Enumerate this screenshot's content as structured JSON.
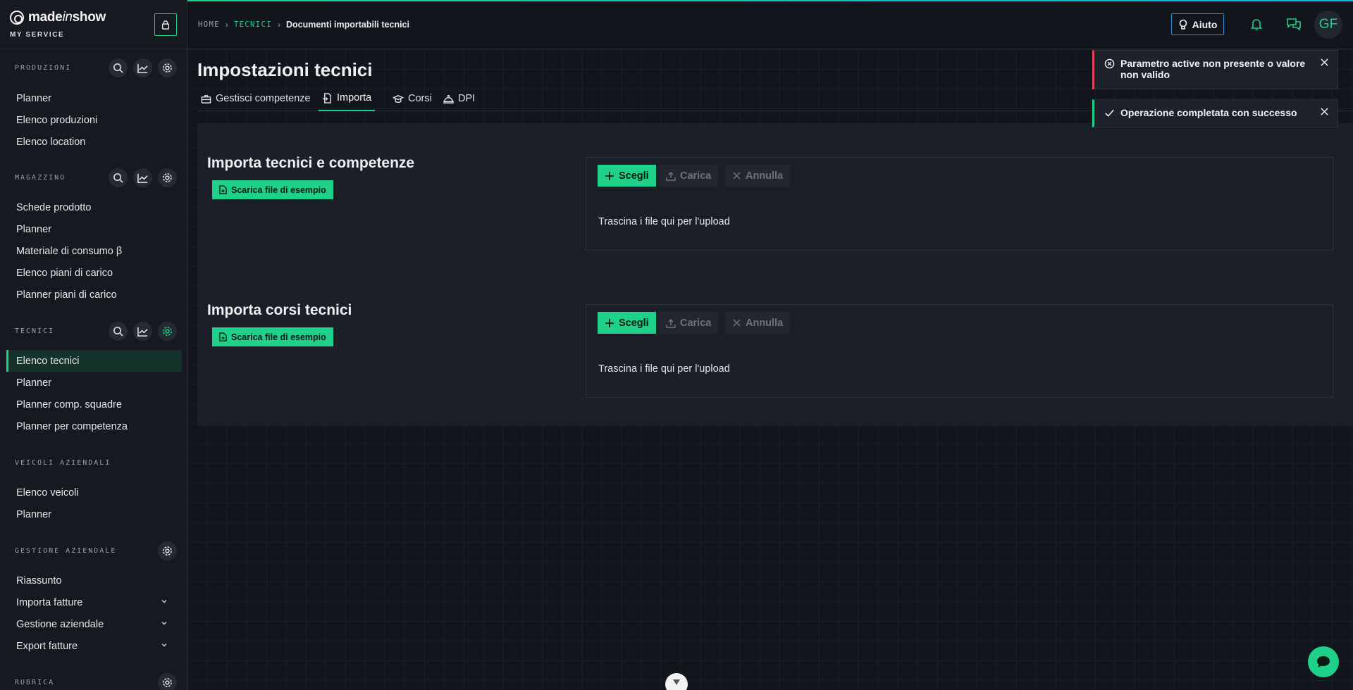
{
  "brand": {
    "name_pre": "made",
    "name_mid": "in",
    "name_post": "show",
    "subtitle": "MY SERVICE"
  },
  "colors": {
    "accent": "#1fd08a",
    "help_border": "#2f8fd6",
    "error": "#e0455a"
  },
  "sidebar": {
    "sections": [
      {
        "title": "PRODUZIONI",
        "items": [
          "Planner",
          "Elenco produzioni",
          "Elenco location"
        ]
      },
      {
        "title": "MAGAZZINO",
        "items": [
          "Schede prodotto",
          "Planner",
          "Materiale di consumo β",
          "Elenco piani di carico",
          "Planner piani di carico"
        ]
      },
      {
        "title": "TECNICI",
        "items": [
          "Elenco tecnici",
          "Planner",
          "Planner comp. squadre",
          "Planner per competenza"
        ],
        "active_item": "Elenco tecnici"
      },
      {
        "title": "VEICOLI AZIENDALI",
        "items": [
          "Elenco veicoli",
          "Planner"
        ]
      },
      {
        "title": "GESTIONE AZIENDALE",
        "items": [
          "Riassunto",
          "Importa fatture",
          "Gestione aziendale",
          "Export fatture"
        ]
      },
      {
        "title": "RUBRICA",
        "items": []
      }
    ]
  },
  "header": {
    "breadcrumb": {
      "home": "HOME",
      "section": "TECNICI",
      "current": "Documenti importabili tecnici"
    },
    "help_label": "Aiuto",
    "avatar_initials": "GF"
  },
  "main": {
    "title": "Impostazioni tecnici",
    "tabs": [
      {
        "label": "Gestisci competenze",
        "icon": "briefcase-icon"
      },
      {
        "label": "Importa",
        "icon": "file-import-icon",
        "active": true
      },
      {
        "label": "Corsi",
        "icon": "graduation-cap-icon"
      },
      {
        "label": "DPI",
        "icon": "hard-hat-icon"
      }
    ],
    "imports": [
      {
        "title": "Importa tecnici e competenze",
        "download_label": "Scarica file di esempio",
        "choose": "Scegli",
        "upload": "Carica",
        "cancel": "Annulla",
        "drop_text": "Trascina i file qui per l'upload"
      },
      {
        "title": "Importa corsi tecnici",
        "download_label": "Scarica file di esempio",
        "choose": "Scegli",
        "upload": "Carica",
        "cancel": "Annulla",
        "drop_text": "Trascina i file qui per l'upload"
      }
    ]
  },
  "toasts": [
    {
      "type": "error",
      "message": "Parametro active non presente o valore non valido"
    },
    {
      "type": "success",
      "message": "Operazione completata con successo"
    }
  ]
}
